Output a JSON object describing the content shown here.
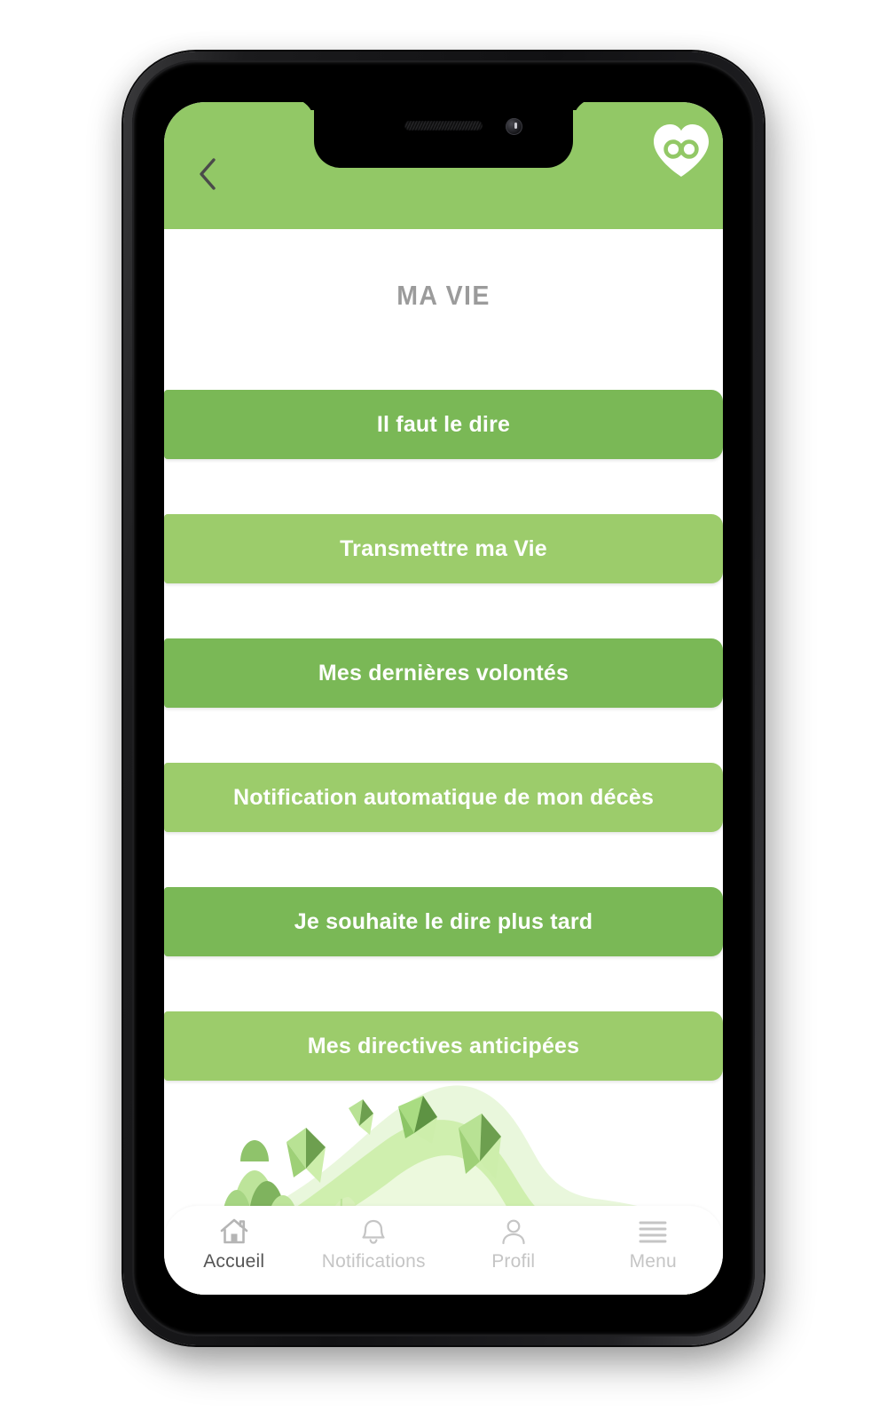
{
  "app": {
    "accent_dark": "#7ab856",
    "accent_light": "#9ccc6b",
    "header_green": "#92c866",
    "title_gray": "#9b9b9b",
    "nav_inactive": "#c5c5c5",
    "nav_active": "#555555"
  },
  "header": {
    "back_icon": "chevron-left-icon",
    "logo_icon": "heart-infinity-logo"
  },
  "page": {
    "title": "MA VIE"
  },
  "menu": {
    "items": [
      {
        "label": "Il faut le dire",
        "tone": "dark"
      },
      {
        "label": "Transmettre ma Vie",
        "tone": "light"
      },
      {
        "label": "Mes dernières volontés",
        "tone": "dark"
      },
      {
        "label": "Notification automatique de mon décès",
        "tone": "light"
      },
      {
        "label": "Je souhaite le dire plus tard",
        "tone": "dark"
      },
      {
        "label": "Mes directives anticipées",
        "tone": "light"
      }
    ]
  },
  "bottom_nav": {
    "items": [
      {
        "label": "Accueil",
        "icon": "home-icon",
        "active": true
      },
      {
        "label": "Notifications",
        "icon": "bell-icon",
        "active": false
      },
      {
        "label": "Profil",
        "icon": "user-icon",
        "active": false
      },
      {
        "label": "Menu",
        "icon": "hamburger-icon",
        "active": false
      }
    ]
  }
}
